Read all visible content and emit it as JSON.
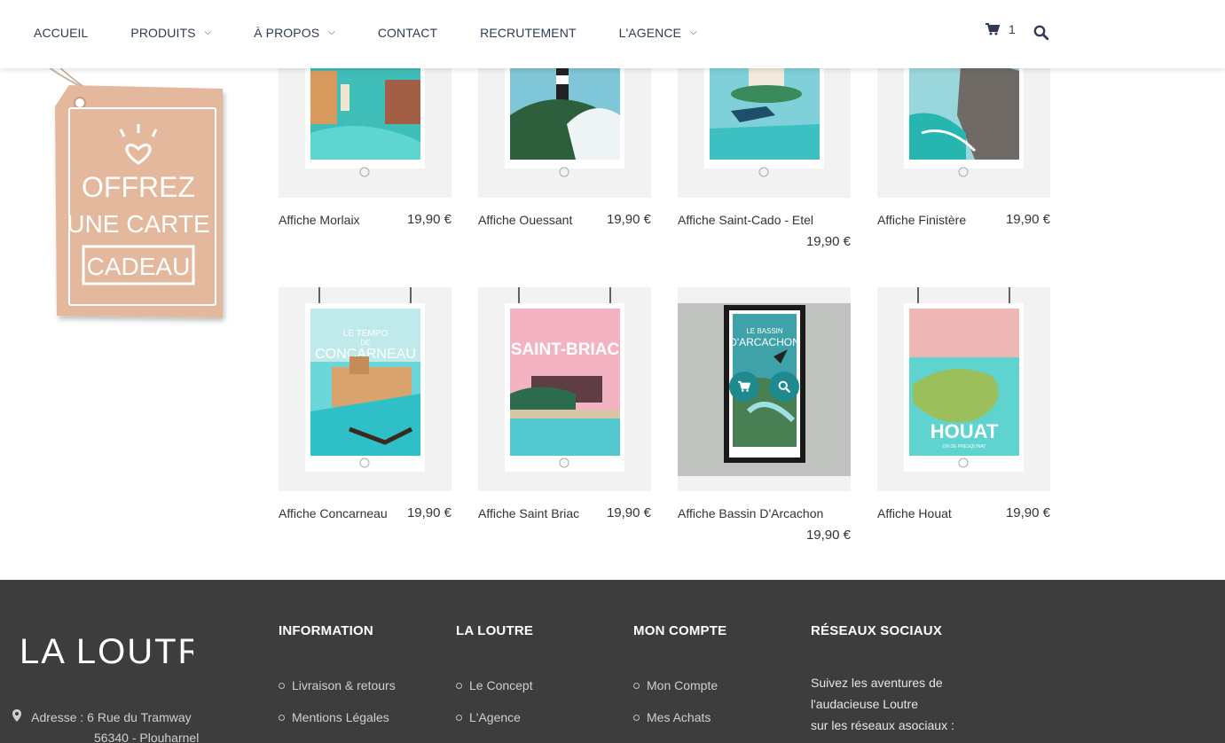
{
  "nav": {
    "items": [
      {
        "label": "ACCUEIL",
        "has_dropdown": false
      },
      {
        "label": "PRODUITS",
        "has_dropdown": true
      },
      {
        "label": "À PROPOS",
        "has_dropdown": true
      },
      {
        "label": "CONTACT",
        "has_dropdown": false
      },
      {
        "label": "RECRUTEMENT",
        "has_dropdown": false
      },
      {
        "label": "L'AGENCE",
        "has_dropdown": true
      }
    ],
    "cart_count": "1",
    "cart_icon": "shopping-cart-icon",
    "search_icon": "search-icon"
  },
  "gift_card": {
    "lines": [
      "OFFREZ",
      "UNE CARTE",
      "CADEAU"
    ]
  },
  "products": [
    {
      "name": "Affiche Morlaix",
      "price": "19,90 €"
    },
    {
      "name": "Affiche Ouessant",
      "price": "19,90 €"
    },
    {
      "name": "Affiche Saint-Cado - Etel",
      "price": "19,90 €"
    },
    {
      "name": "Affiche Finistère",
      "price": "19,90 €"
    },
    {
      "name": "Affiche Concarneau",
      "price": "19,90 €"
    },
    {
      "name": "Affiche Saint Briac",
      "price": "19,90 €"
    },
    {
      "name": "Affiche Bassin D'Arcachon",
      "price": "19,90 €"
    },
    {
      "name": "Affiche Houat",
      "price": "19,90 €"
    }
  ],
  "poster_texts": {
    "concarneau": [
      "LE TEMPO",
      "DE",
      "CONCARNEAU"
    ],
    "saint_briac": [
      "SAINT-BRIAC"
    ],
    "arcachon": [
      "LE BASSIN",
      "D'ARCACHON"
    ],
    "houat": [
      "HOUAT",
      "ON DE PRESQU'NAT"
    ]
  },
  "footer": {
    "logo_text": "LA LOUTRE",
    "address_label": "Adresse : 6 Rue du Tramway",
    "address_city": "56340 - Plouharnel",
    "columns": [
      {
        "title": "INFORMATION",
        "links": [
          "Livraison & retours",
          "Mentions Légales"
        ]
      },
      {
        "title": "LA LOUTRE",
        "links": [
          "Le Concept",
          "L'Agence"
        ]
      },
      {
        "title": "MON COMPTE",
        "links": [
          "Mon Compte",
          "Mes Achats"
        ]
      },
      {
        "title": "RÉSEAUX SOCIAUX",
        "links": []
      }
    ],
    "social_text": [
      "Suivez les aventures de",
      "l'audacieuse Loutre",
      "sur les réseaux asociaux :"
    ]
  },
  "colors": {
    "nav_text": "#2f3b53",
    "footer_bg": "#3d3d3d",
    "accent_teal": "#1f8a8d"
  }
}
